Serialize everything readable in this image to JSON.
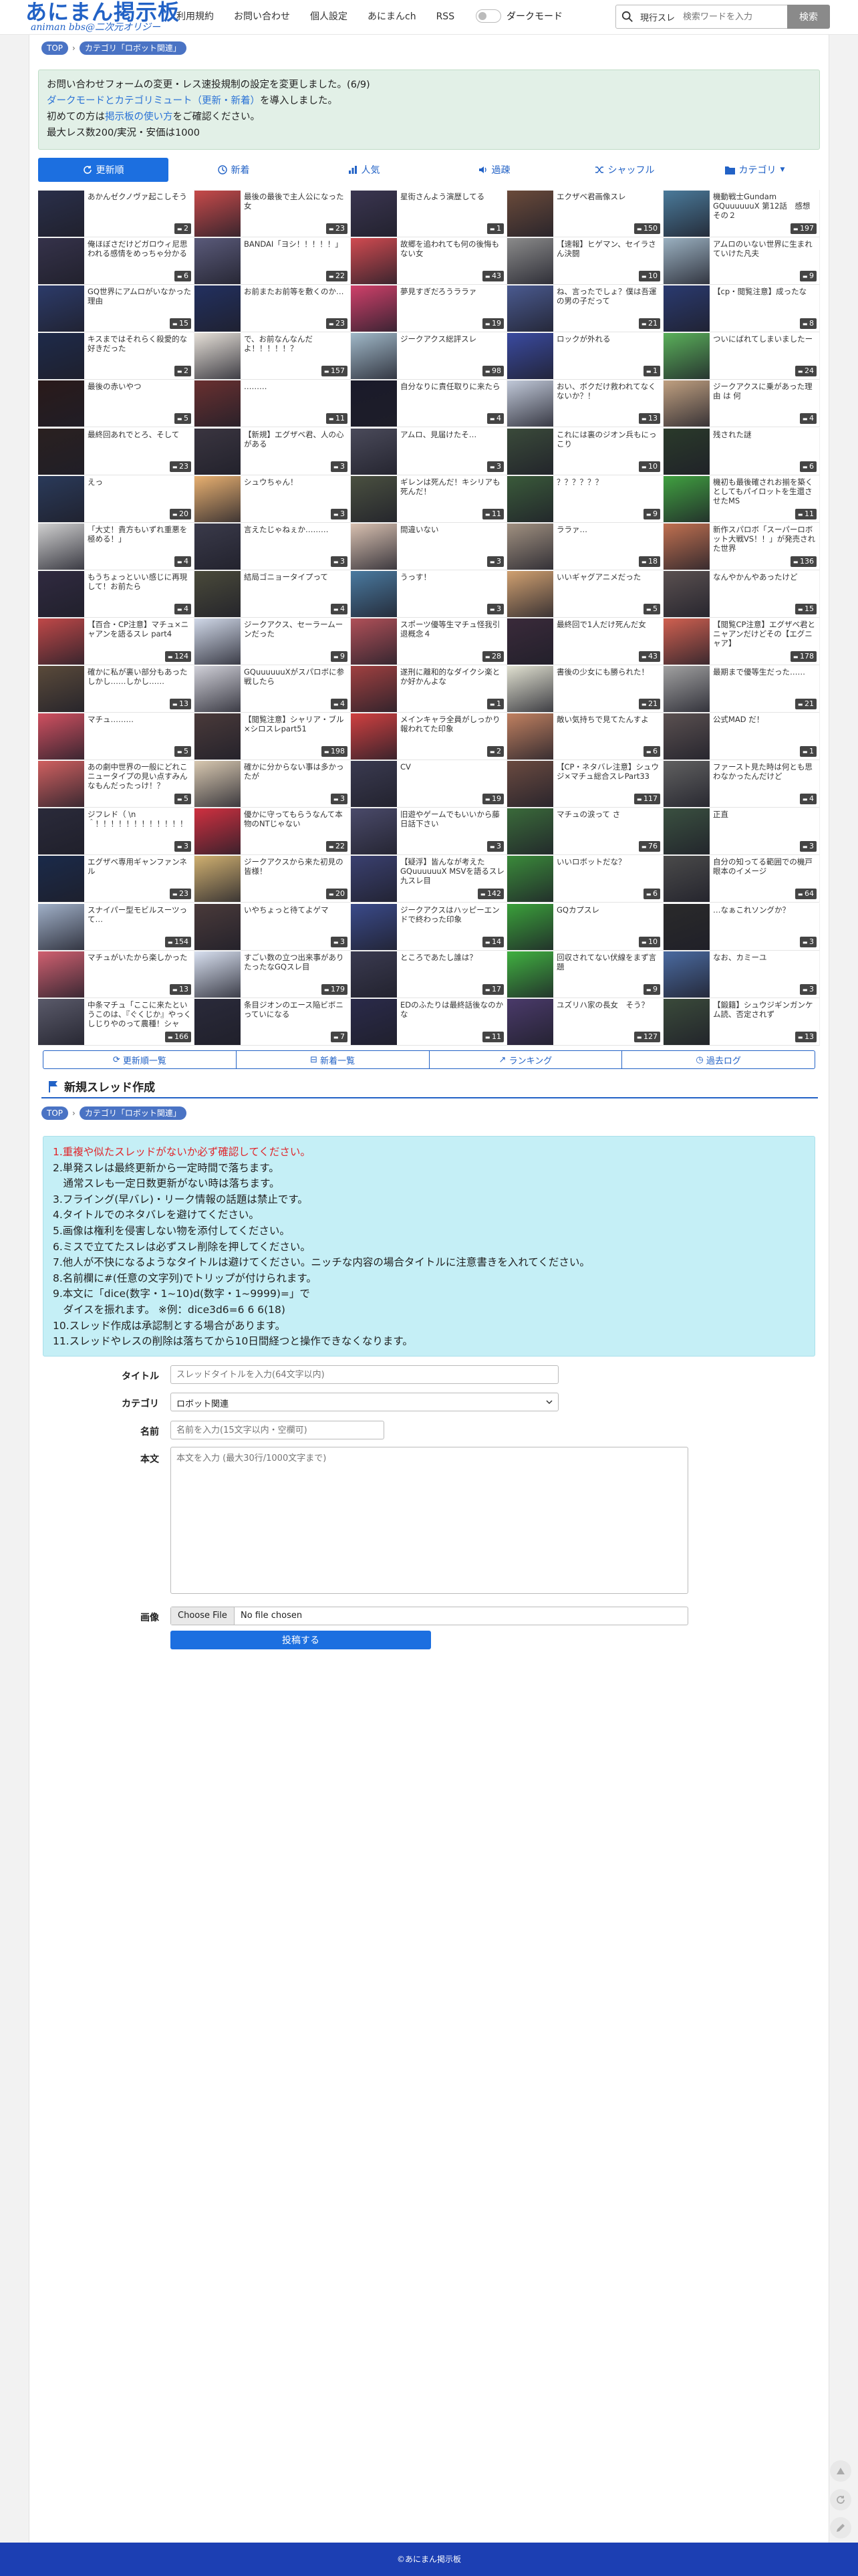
{
  "header": {
    "logo_title": "あにまん掲示板",
    "logo_sub": "animan bbs@二次元オリジー",
    "nav": [
      "利用規約",
      "お問い合わせ",
      "個人設定",
      "あにまんch",
      "RSS"
    ],
    "dark_mode_label": "ダークモード",
    "search_filter": "現行スレ",
    "search_placeholder": "検索ワードを入力",
    "search_button": "検索"
  },
  "breadcrumb": {
    "top": "TOP",
    "category": "カテゴリ「ロボット関連」"
  },
  "notice": {
    "line1": "お問い合わせフォームの変更・レス速投規制の設定を変更しました。(6/9)",
    "line2_link": "ダークモードとカテゴリミュート（更新・新着）",
    "line2_rest": "を導入しました。",
    "line3_pre": "初めての方は",
    "line3_link": "掲示板の使い方",
    "line3_post": "をご確認ください。",
    "line4": "最大レス数200/実況・安価は1000"
  },
  "tabs": [
    "更新順",
    "新着",
    "人気",
    "過疎",
    "シャッフル",
    "カテゴリ"
  ],
  "threads": [
    {
      "title": "あかんゼクノヴァ起こしそう",
      "count": "2",
      "bg": "#2a2f4a"
    },
    {
      "title": "最後の最後で主人公になった女",
      "count": "23",
      "bg": "#c74a4a"
    },
    {
      "title": "星街さんよう演歴してる",
      "count": "1",
      "bg": "#3a3550"
    },
    {
      "title": "エクザベ君画像スレ",
      "count": "150",
      "bg": "#6a4a3a"
    },
    {
      "title": "機動戦士Gundam GQuuuuuuX 第12話　感想その２",
      "count": "197",
      "bg": "#4a7a9a"
    },
    {
      "title": "俺ほぼさだけどガロウィ尼思われる感情をめっちゃ分かる",
      "count": "6",
      "bg": "#35324a"
    },
    {
      "title": "BANDAI「ヨシ！！！！！」",
      "count": "22",
      "bg": "#5a5a7a"
    },
    {
      "title": "故郷を追われても何の後悔もない女",
      "count": "43",
      "bg": "#d04a50"
    },
    {
      "title": "【速報】ヒゲマン、セイラさん決闘",
      "count": "10",
      "bg": "#8a8a8a"
    },
    {
      "title": "アムロのいない世界に生まれていけた凡夫",
      "count": "9",
      "bg": "#9ab0c0"
    },
    {
      "title": "GQ世界にアムロがいなかった理由",
      "count": "15",
      "bg": "#2c3b6a"
    },
    {
      "title": "お前またお前等を敷くのか…",
      "count": "23",
      "bg": "#223060"
    },
    {
      "title": "夢見すぎだろうララァ",
      "count": "19",
      "bg": "#d0406a"
    },
    {
      "title": "ね、言ったでしょ？僕は吾運の男の子だって",
      "count": "21",
      "bg": "#4a5a90"
    },
    {
      "title": "【cp・閲覧注意】成ったな",
      "count": "8",
      "bg": "#2a3a70"
    },
    {
      "title": "キスまではそれらく殺愛的な好きだった",
      "count": "2",
      "bg": "#1e2a4a"
    },
    {
      "title": "で、お前なんなんだよ！！！！！？",
      "count": "157",
      "bg": "#e6e0d8"
    },
    {
      "title": "ジークアクス総評スレ",
      "count": "98",
      "bg": "#a0b8c8"
    },
    {
      "title": "ロックが外れる",
      "count": "1",
      "bg": "#3a4aa0"
    },
    {
      "title": "ついにばれてしまいましたー",
      "count": "24",
      "bg": "#5ab05a"
    },
    {
      "title": "最後の赤いやつ",
      "count": "5",
      "bg": "#2a1a1a"
    },
    {
      "title": "………",
      "count": "11",
      "bg": "#6a3030"
    },
    {
      "title": "自分なりに責任取りに来たら",
      "count": "4",
      "bg": "#1a1a2a"
    },
    {
      "title": "おい、ボクだけ救われてなくないか？！",
      "count": "13",
      "bg": "#c0c8d8"
    },
    {
      "title": "ジークアクスに乗があった理由 は 何",
      "count": "4",
      "bg": "#c0a080"
    },
    {
      "title": "最終回あれでとろ、そして",
      "count": "23",
      "bg": "#2a2020"
    },
    {
      "title": "【新規】エグザベ君、人の心がある",
      "count": "3",
      "bg": "#3a3540"
    },
    {
      "title": "アムロ、見届けたそ…",
      "count": "3",
      "bg": "#4a4a5a"
    },
    {
      "title": "これには裏のジオン兵もにっこり",
      "count": "10",
      "bg": "#3a4a3a"
    },
    {
      "title": "残された謎",
      "count": "6",
      "bg": "#2a3a2a"
    },
    {
      "title": "えっ",
      "count": "20",
      "bg": "#2a3a5a"
    },
    {
      "title": "シュウちゃん！",
      "count": "3",
      "bg": "#e8b070"
    },
    {
      "title": "ギレンは死んだ！キシリアも死んだ！",
      "count": "11",
      "bg": "#4a5040"
    },
    {
      "title": "？？？？？？",
      "count": "9",
      "bg": "#3a5a3a"
    },
    {
      "title": "機初も最後確されお揃を築くとしてもパイロットを生還させたMS",
      "count": "11",
      "bg": "#40a040"
    },
    {
      "title": "「大丈！貴方もいずれ重悪を極める！」",
      "count": "4",
      "bg": "#d0d0d0"
    },
    {
      "title": "言えたじゃねぇか………",
      "count": "3",
      "bg": "#3a3a4a"
    },
    {
      "title": "間違いない",
      "count": "3",
      "bg": "#d8c0b0"
    },
    {
      "title": "ララァ…",
      "count": "18",
      "bg": "#a09080"
    },
    {
      "title": "新作スパロボ「スーパーロボット大戦VS！！」が発売された世界",
      "count": "136",
      "bg": "#c07050"
    },
    {
      "title": "もうちょっといい感じに再現して！お前たら",
      "count": "4",
      "bg": "#302a40"
    },
    {
      "title": "結局ゴニョータイプって",
      "count": "4",
      "bg": "#4a4a3a"
    },
    {
      "title": "うっす！",
      "count": "3",
      "bg": "#4a7aa0"
    },
    {
      "title": "いいギャグアニメだった",
      "count": "5",
      "bg": "#d0a070"
    },
    {
      "title": "なんやかんやあったけど",
      "count": "15",
      "bg": "#5a5050"
    },
    {
      "title": "【百合・CP注意】マチュ×ニャアンを語るスレ part4",
      "count": "124",
      "bg": "#c04848"
    },
    {
      "title": "ジークアクス、セーラームーンだった",
      "count": "9",
      "bg": "#d0d8e8"
    },
    {
      "title": "スポーツ優等生マチュ怪我引退概念４",
      "count": "28",
      "bg": "#b05058"
    },
    {
      "title": "最終回で1人だけ死んだ女",
      "count": "43",
      "bg": "#3a2a3a"
    },
    {
      "title": "【閲覧CP注意】エグザベ君とニャアンだけどその【エグニャア】",
      "count": "178",
      "bg": "#d06050"
    },
    {
      "title": "確かに私が裏い部分もあったしかし……しかし……",
      "count": "13",
      "bg": "#5a4a3a"
    },
    {
      "title": "GQuuuuuuXがスパロボに参戦したら",
      "count": "4",
      "bg": "#d0d0d8"
    },
    {
      "title": "遂刑に離和的なダイクシ楽とか好かんよな",
      "count": "1",
      "bg": "#a04040"
    },
    {
      "title": "書後の少女にも勝られた！",
      "count": "21",
      "bg": "#e0e0d0"
    },
    {
      "title": "最期まで優等生だった……",
      "count": "21",
      "bg": "#a0a0a0"
    },
    {
      "title": "マチュ………",
      "count": "5",
      "bg": "#d05060"
    },
    {
      "title": "【閲覧注意】シャリア・ブル×シロスレpart51",
      "count": "198",
      "bg": "#4a3a3a"
    },
    {
      "title": "メインキャラ全員がしっかり報われてた印象",
      "count": "2",
      "bg": "#d04040"
    },
    {
      "title": "敵い気持ちで見てたんすよ",
      "count": "6",
      "bg": "#c08060"
    },
    {
      "title": "公式MAD だ！",
      "count": "1",
      "bg": "#5a5050"
    },
    {
      "title": "あの劇中世界の一般にどれこニュータイプの見い点すみんなもんだったっけ！？",
      "count": "5",
      "bg": "#d06060"
    },
    {
      "title": "確かに分からない事は多かったが",
      "count": "3",
      "bg": "#d8c8b0"
    },
    {
      "title": "CV",
      "count": "19",
      "bg": "#3a3a50"
    },
    {
      "title": "【CP・ネタバレ注意】シュウジ×マチュ総合スレPart33",
      "count": "117",
      "bg": "#6a4a40"
    },
    {
      "title": "ファースト見た時は何とも思わなかったんだけど",
      "count": "4",
      "bg": "#606060"
    },
    {
      "title": "ジフレド（ \\n＾！！！！！！！！！！！！",
      "count": "3",
      "bg": "#2a2a3a"
    },
    {
      "title": "優かに守ってもらうなんて本物のNTじゃない",
      "count": "22",
      "bg": "#d03040"
    },
    {
      "title": "旧遊やゲームでもいいから藤日話下さい",
      "count": "3",
      "bg": "#4a4a6a"
    },
    {
      "title": "マチュの涙って さ",
      "count": "76",
      "bg": "#3a6a3a"
    },
    {
      "title": "正直",
      "count": "3",
      "bg": "#3a5040"
    },
    {
      "title": "エグザベ専用ギャンファンネル",
      "count": "23",
      "bg": "#1a2a4a"
    },
    {
      "title": "ジークアクスから来た初見の皆様！",
      "count": "20",
      "bg": "#d0b070"
    },
    {
      "title": "【疑浮】皆んなが考えたGQuuuuuuX MSVを語るスレ九スレ目",
      "count": "142",
      "bg": "#3a4070"
    },
    {
      "title": "いいロボットだな？",
      "count": "6",
      "bg": "#3a8a3a"
    },
    {
      "title": "自分の知ってる範囲での機戸眼本のイメージ",
      "count": "64",
      "bg": "#4a4a4a"
    },
    {
      "title": "スナイパー型モビルスーツって…",
      "count": "154",
      "bg": "#a0b0c8"
    },
    {
      "title": "いやちょっと待てよゲマ",
      "count": "3",
      "bg": "#4a3a3a"
    },
    {
      "title": "ジークアクスはハッピーエンドで終わった印象",
      "count": "14",
      "bg": "#3a4a8a"
    },
    {
      "title": "GQカプスレ",
      "count": "10",
      "bg": "#3aa03a"
    },
    {
      "title": "…なぁこれソングか？",
      "count": "3",
      "bg": "#2a2a2a"
    },
    {
      "title": "マチュがいたから楽しかった",
      "count": "13",
      "bg": "#d06070"
    },
    {
      "title": "すごい数の立つ出来事がありたったなGQスレ目",
      "count": "179",
      "bg": "#d8e0f0"
    },
    {
      "title": "ところであたし誰は？",
      "count": "17",
      "bg": "#3a3a50"
    },
    {
      "title": "回収されてない伏線をまず言題",
      "count": "9",
      "bg": "#40b040"
    },
    {
      "title": "なお、カミーユ",
      "count": "3",
      "bg": "#4a6aa0"
    },
    {
      "title": "中条マチュ「ここに来たというこのは、『ぐくじか』やっくしじりやのって農種！シャア！」part4",
      "count": "166",
      "bg": "#5a5a6a"
    },
    {
      "title": "条目ジオンのエース陥ビボニっていになる",
      "count": "7",
      "bg": "#2a2a3a"
    },
    {
      "title": "EDのふたりは最終話後なのかな",
      "count": "11",
      "bg": "#2a2a4a"
    },
    {
      "title": "ユズリハ家の長女　そう？",
      "count": "127",
      "bg": "#4a3a6a"
    },
    {
      "title": "【鍛籍】シュウジギンガンケム読、否定されず",
      "count": "13",
      "bg": "#3a4a3a"
    }
  ],
  "subnav": [
    "更新順一覧",
    "新着一覧",
    "ランキング",
    "過去ログ"
  ],
  "new_thread": {
    "title": "新規スレッド作成",
    "rules": [
      "1.重複や似たスレッドがないか必ず確認してください。",
      "2.単発スレは最終更新から一定時間で落ちます。",
      "　通常スレも一定日数更新がない時は落ちます。",
      "3.フライング(早バレ)・リーク情報の話題は禁止です。",
      "4.タイトルでのネタバレを避けてください。",
      "5.画像は権利を侵害しない物を添付してください。",
      "6.ミスで立てたスレは必ずスレ削除を押してください。",
      "7.他人が不快になるようなタイトルは避けてください。ニッチな内容の場合タイトルに注意書きを入れてください。",
      "8.名前欄に#(任意の文字列)でトリップが付けられます。",
      "9.本文に「dice(数字・1~10)d(数字・1~9999)=」で",
      "　ダイスを振れます。 ※例：dice3d6=6 6 6(18)",
      "10.スレッド作成は承認制とする場合があります。",
      "11.スレッドやレスの削除は落ちてから10日間経つと操作できなくなります。"
    ],
    "label_title": "タイトル",
    "placeholder_title": "スレッドタイトルを入力(64文字以内)",
    "label_category": "カテゴリ",
    "category_value": "ロボット関連",
    "label_name": "名前",
    "placeholder_name": "名前を入力(15文字以内・空欄可)",
    "label_body": "本文",
    "placeholder_body": "本文を入力 (最大30行/1000文字まで)",
    "label_image": "画像",
    "choose_file": "Choose File",
    "no_file": "No file chosen",
    "submit": "投稿する"
  },
  "footer": "©あにまん掲示板"
}
